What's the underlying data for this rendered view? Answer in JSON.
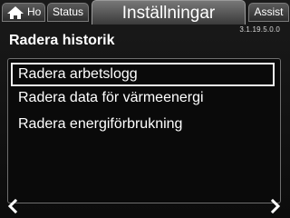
{
  "tabs": {
    "home_label": "Ho",
    "status_label": "Status",
    "active_label": "Inställningar",
    "assist_label": "Assist"
  },
  "version": "3.1.19.5.0.0",
  "page_title": "Radera historik",
  "menu": {
    "items": [
      {
        "label": "Radera arbetslogg",
        "selected": true
      },
      {
        "label": "Radera data för värmeenergi",
        "selected": false
      },
      {
        "label": "Radera energiförbrukning",
        "selected": false
      }
    ]
  },
  "icons": {
    "home": "home-icon",
    "prev": "chevron-left-icon",
    "next": "chevron-right-icon"
  }
}
